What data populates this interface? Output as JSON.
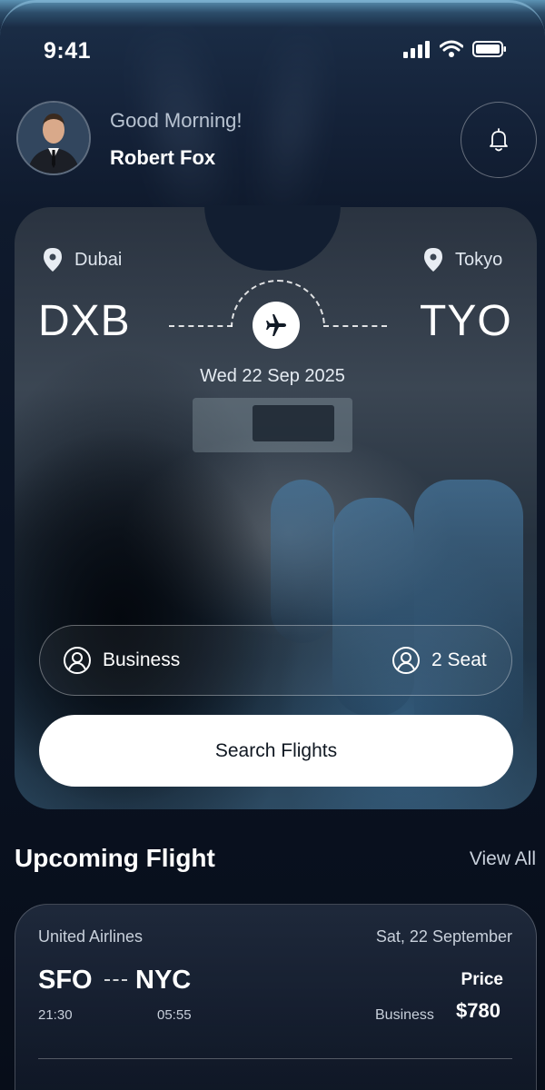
{
  "status_bar": {
    "time": "9:41"
  },
  "header": {
    "greeting": "Good Morning!",
    "name": "Robert Fox"
  },
  "booking": {
    "from": {
      "city": "Dubai",
      "code": "DXB"
    },
    "to": {
      "city": "Tokyo",
      "code": "TYO"
    },
    "date": "Wed 22 Sep 2025",
    "class_label": "Business",
    "seats_label": "2 Seat",
    "search_label": "Search Flights"
  },
  "upcoming": {
    "title": "Upcoming Flight",
    "view_all": "View All",
    "flight": {
      "airline": "United Airlines",
      "date": "Sat, 22 September",
      "from_code": "SFO",
      "to_code": "NYC",
      "depart_time": "21:30",
      "arrive_time": "05:55",
      "price_label": "Price",
      "class": "Business",
      "price": "$780"
    }
  },
  "icons": {
    "notification": "bell-icon",
    "location": "location-pin-icon",
    "plane": "airplane-icon",
    "user": "user-circle-icon"
  },
  "colors": {
    "accent": "#ffffff",
    "background": "#0b1424"
  }
}
